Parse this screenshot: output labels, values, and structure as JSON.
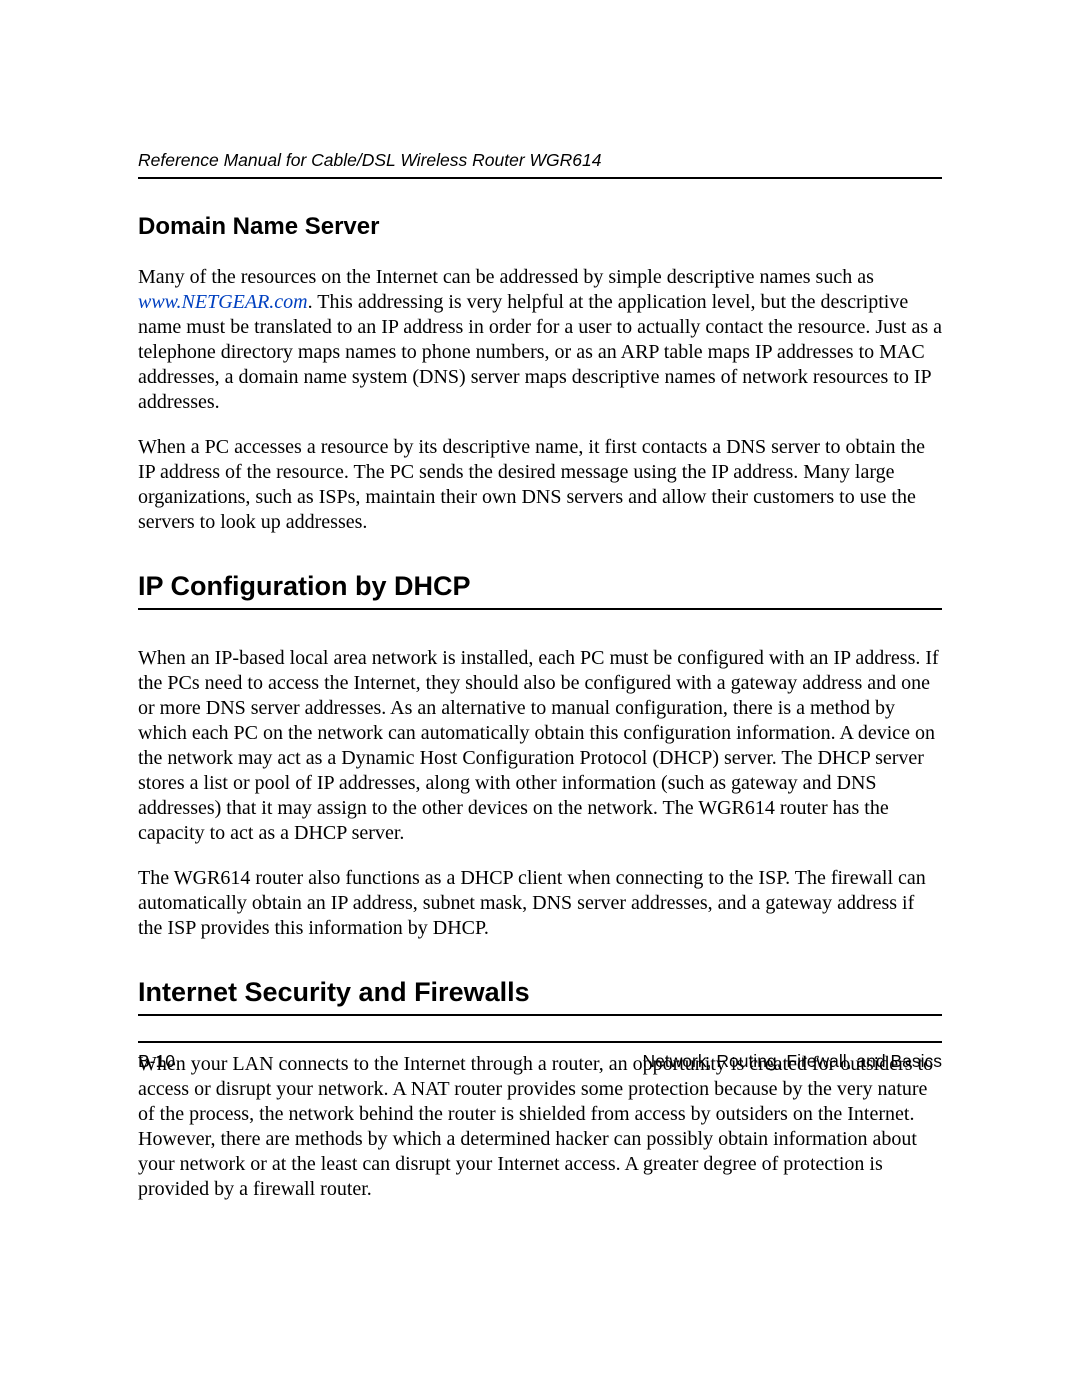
{
  "header": {
    "title": "Reference Manual for Cable/DSL Wireless Router WGR614"
  },
  "sections": {
    "dns": {
      "heading": "Domain Name Server",
      "p1_a": "Many of the resources on the Internet can be addressed by simple descriptive names such as ",
      "link": "www.NETGEAR.com",
      "p1_b": ". This addressing is very helpful at the application level, but the descriptive name must be translated to an IP address in order for a user to actually contact the resource. Just as a telephone directory maps names to phone numbers, or as an ARP table maps IP addresses to MAC addresses, a domain name system (DNS) server maps descriptive names of network resources to IP addresses.",
      "p2": "When a PC accesses a resource by its descriptive name, it first contacts a DNS server to obtain the IP address of the resource. The PC sends the desired message using the IP address. Many large organizations, such as ISPs, maintain their own DNS servers and allow their customers to use the servers to look up addresses."
    },
    "dhcp": {
      "heading": "IP Configuration by DHCP",
      "p1": "When an IP-based local area network is installed, each PC must be configured with an IP address. If the PCs need to access the Internet, they should also be configured with a gateway address and one or more DNS server addresses. As an alternative to manual configuration, there is a method by which each PC on the network can automatically obtain this configuration information. A device on the network may act as a Dynamic Host Configuration Protocol (DHCP) server. The DHCP server stores a list or pool of IP addresses, along with other information (such as gateway and DNS addresses) that it may assign to the other devices on the network. The WGR614 router has the capacity to act as a DHCP server.",
      "p2": "The WGR614 router also functions as a DHCP client when connecting to the ISP. The firewall can automatically obtain an IP address, subnet mask, DNS server addresses, and a gateway address if the ISP provides this information by DHCP."
    },
    "firewall": {
      "heading": "Internet Security and Firewalls",
      "p1": "When your LAN connects to the Internet through a router, an opportunity is created for outsiders to access or disrupt your network. A NAT router provides some protection because by the very nature of the process, the network behind the router is shielded from access by outsiders on the Internet. However, there are methods by which a determined hacker can possibly obtain information about your network or at the least can disrupt your Internet access. A greater degree of protection is provided by a firewall router."
    }
  },
  "footer": {
    "page": "B-10",
    "chapter": "Network, Routing, Firewall, and Basics"
  }
}
